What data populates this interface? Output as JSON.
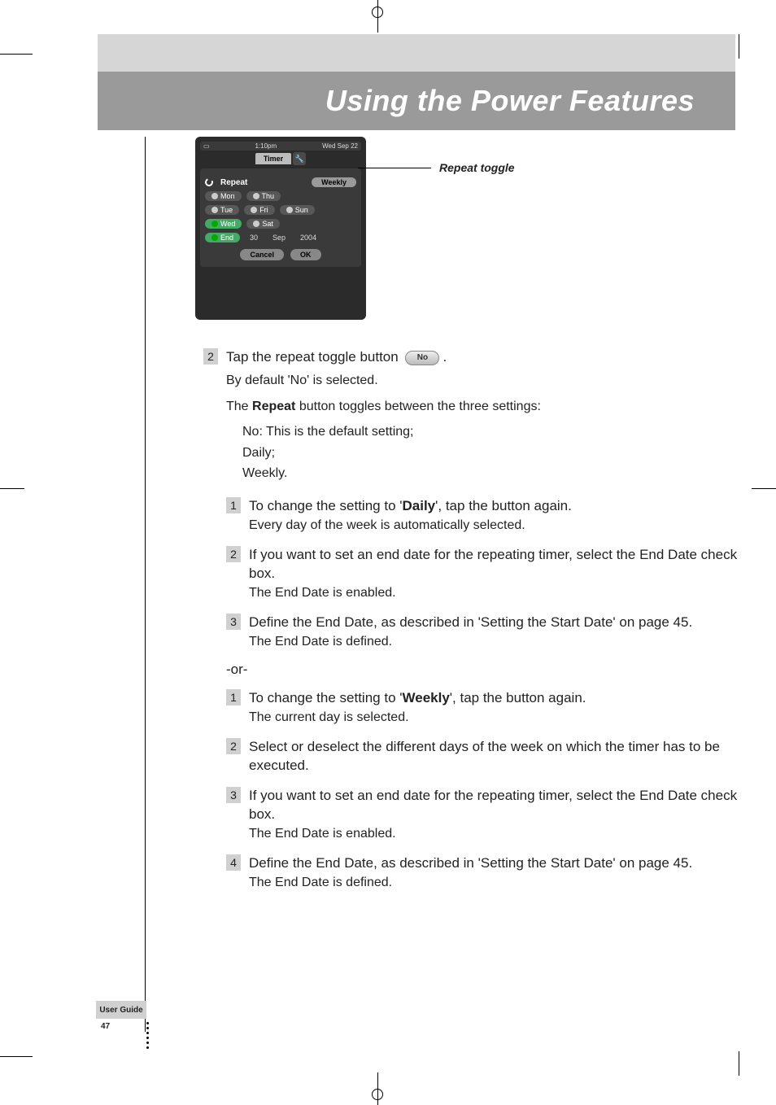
{
  "header": {
    "title": "Using the Power Features"
  },
  "figure": {
    "status_time": "1:10pm",
    "status_date": "Wed Sep 22",
    "tab_label": "Timer",
    "repeat_label": "Repeat",
    "repeat_value": "Weekly",
    "days": {
      "mon": "Mon",
      "tue": "Tue",
      "wed": "Wed",
      "thu": "Thu",
      "fri": "Fri",
      "sat": "Sat",
      "sun": "Sun"
    },
    "end_label": "End",
    "end_day": "30",
    "end_month": "Sep",
    "end_year": "2004",
    "cancel": "Cancel",
    "ok": "OK",
    "callout": "Repeat toggle"
  },
  "step_main": {
    "num": "2",
    "line1a": "Tap the repeat toggle button ",
    "no_btn": "No",
    "line1b": ".",
    "sub1": "By default 'No' is selected.",
    "sub2a": "The ",
    "sub2bold": "Repeat",
    "sub2b": " button toggles between the three settings:",
    "opt1": "No: This is the default setting;",
    "opt2": "Daily;",
    "opt3": "Weekly."
  },
  "daily_steps": {
    "s1": {
      "num": "1",
      "a": "To change the setting to '",
      "bold": "Daily",
      "b": "', tap the button again.",
      "sub": "Every day of the week is automatically selected."
    },
    "s2": {
      "num": "2",
      "main": "If you want to set an end date for the repeating timer, select the End Date check box.",
      "sub": "The End Date is enabled."
    },
    "s3": {
      "num": "3",
      "main": "Define the End Date, as described in 'Setting the Start Date' on page 45.",
      "sub": "The End Date is defined."
    }
  },
  "or": "-or-",
  "weekly_steps": {
    "s1": {
      "num": "1",
      "a": "To change the setting to '",
      "bold": "Weekly",
      "b": "', tap the button again.",
      "sub": "The current day is selected."
    },
    "s2": {
      "num": "2",
      "main": "Select or deselect the different days of the week on which the timer has to be executed."
    },
    "s3": {
      "num": "3",
      "main": "If you want to set an end date for the repeating timer, select the End Date check box.",
      "sub": "The End Date is enabled."
    },
    "s4": {
      "num": "4",
      "main": "Define the End Date, as described in 'Setting the Start Date' on page 45.",
      "sub": "The End Date is defined."
    }
  },
  "footer": {
    "label": "User Guide",
    "page": "47"
  }
}
